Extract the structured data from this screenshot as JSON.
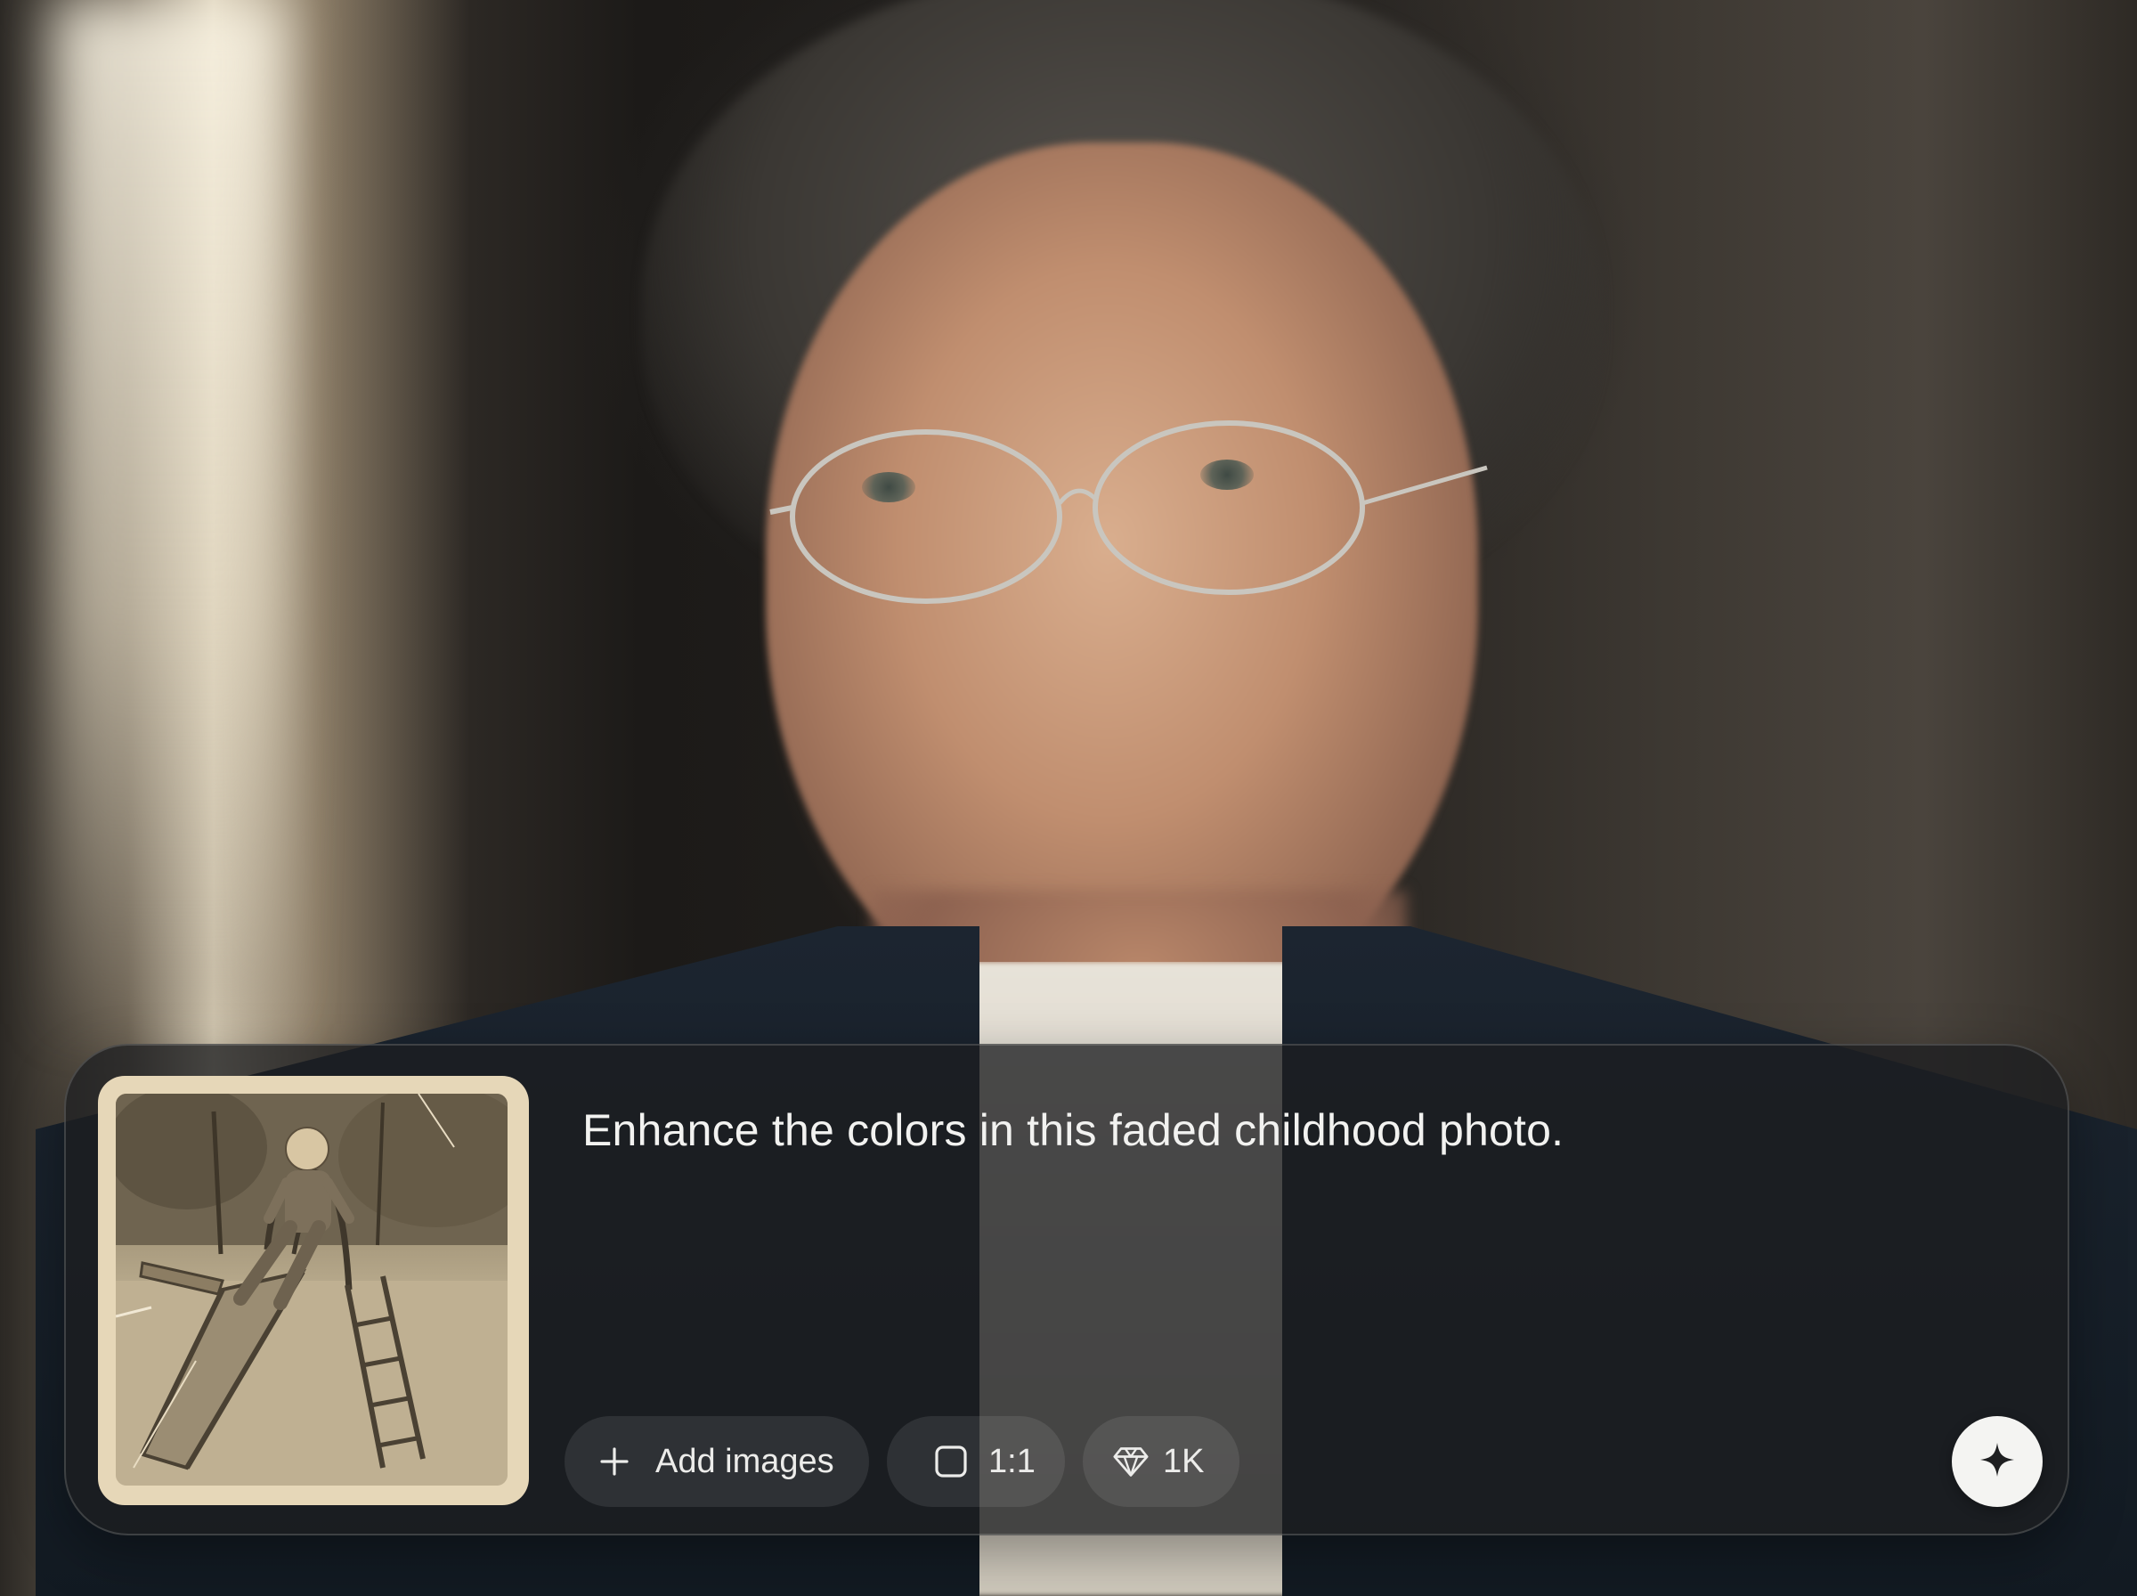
{
  "prompt": {
    "text": "Enhance the colors in this faded childhood photo.",
    "attachment": {
      "kind": "image",
      "description_icon": "attached-photo-thumbnail"
    }
  },
  "toolbar": {
    "add_images_label": "Add images",
    "add_images_icon": "plus-icon",
    "aspect_ratio_label": "1:1",
    "aspect_ratio_icon": "square-icon",
    "quality_label": "1K",
    "quality_icon": "diamond-icon",
    "generate_icon": "sparkle-icon"
  },
  "colors": {
    "panel_bg": "#1c1e20",
    "chip_bg": "#2e3033",
    "text": "#f2f2f0",
    "generate_button_bg": "#f4f4f2"
  }
}
